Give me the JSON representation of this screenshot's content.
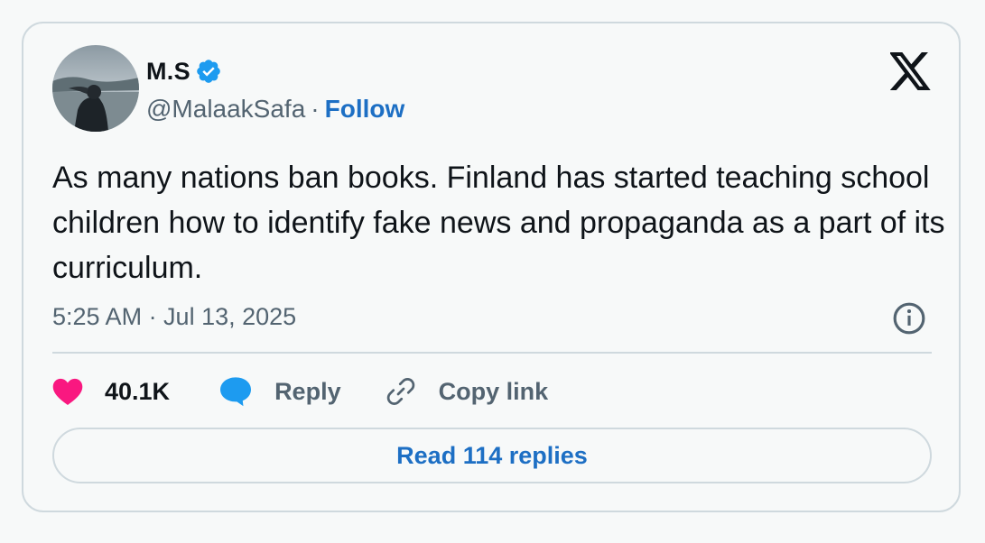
{
  "author": {
    "display_name": "M.S",
    "handle": "@MalaakSafa",
    "separator": "·",
    "follow_label": "Follow",
    "verified": true
  },
  "tweet": {
    "text": "As many nations ban books. Finland has started teaching school children how to identify fake news and propaganda as a part of its curriculum.",
    "timestamp": "5:25 AM · Jul 13, 2025"
  },
  "actions": {
    "likes_count": "40.1K",
    "reply_label": "Reply",
    "copy_link_label": "Copy link",
    "read_replies_label": "Read 114 replies"
  },
  "icons": {
    "brand": "x-logo-icon",
    "verified": "verified-badge-icon",
    "info": "info-icon",
    "like": "heart-icon",
    "reply": "speech-bubble-icon",
    "copy": "link-icon"
  },
  "colors": {
    "accent": "#1d6fc4",
    "heart": "#f91880",
    "reply_bubble": "#1d9bf0",
    "muted_text": "#536471",
    "border": "#cfd9de"
  }
}
